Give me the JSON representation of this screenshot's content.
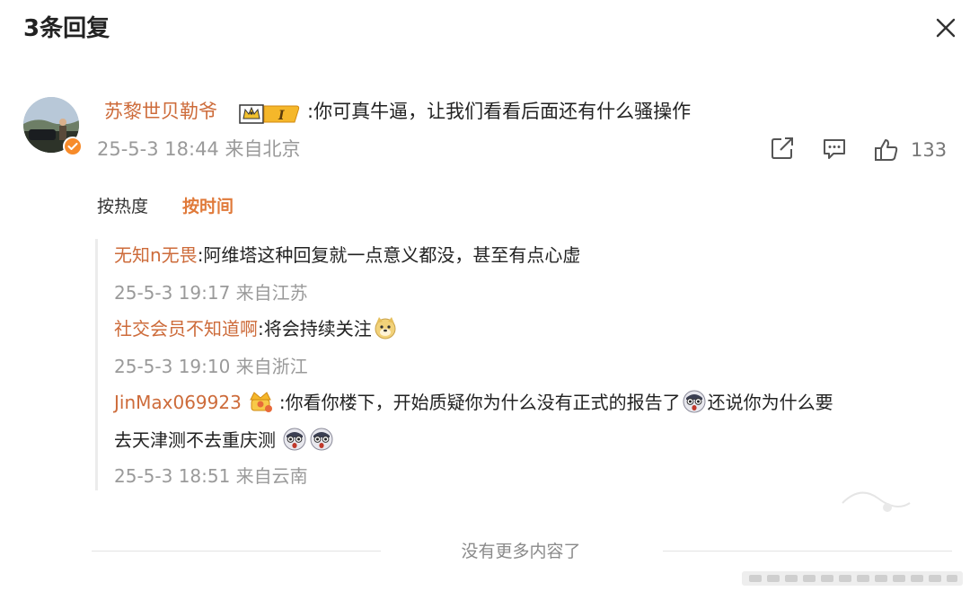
{
  "header": {
    "title": "3条回复"
  },
  "main_comment": {
    "author": "苏黎世贝勒爷",
    "badge_text": "I",
    "text": ":你可真牛逼，让我们看看后面还有什么骚操作",
    "meta": "25-5-3 18:44 来自北京",
    "like_count": "133"
  },
  "sort_tabs": [
    {
      "label": "按热度",
      "active": false
    },
    {
      "label": "按时间",
      "active": true
    }
  ],
  "replies": [
    {
      "author": "无知n无畏",
      "text": ":阿维塔这种回复就一点意义都没，甚至有点心虚",
      "meta": "25-5-3 19:17 来自江苏"
    },
    {
      "author": "社交会员不知道啊",
      "text": ":将会持续关注",
      "meta": "25-5-3 19:10 来自浙江"
    },
    {
      "author": "JinMax069923",
      "text_part1": ":你看你楼下，开始质疑你为什么没有正式的报告了",
      "text_part2": "还说你为什么要",
      "text_line2": "去天津测不去重庆测",
      "meta": "25-5-3 18:51 来自云南"
    }
  ],
  "footer": {
    "text": "没有更多内容了"
  },
  "icons": {
    "close": "close-icon",
    "share": "share-icon",
    "comment": "comment-icon",
    "like": "thumbs-up-icon",
    "verified": "verified-badge-icon",
    "dog": "doge-emoji-icon",
    "shocked": "shocked-face-emoji-icon"
  },
  "colors": {
    "username": "#cd6b3a",
    "active_tab": "#e07a3a",
    "meta": "#9a9a9a",
    "text": "#222222"
  }
}
